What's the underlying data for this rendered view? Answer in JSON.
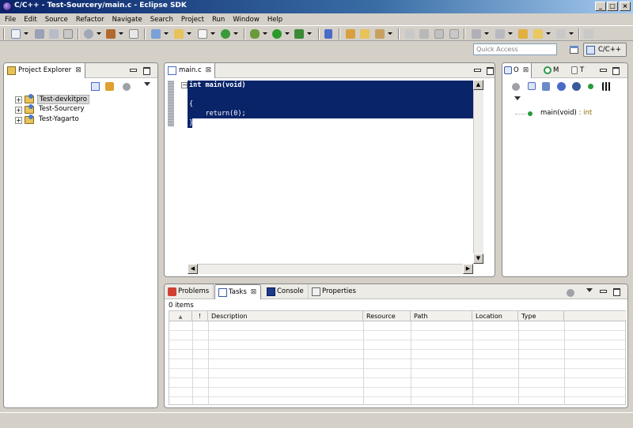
{
  "window": {
    "title": "C/C++ - Test-Sourcery/main.c - Eclipse SDK",
    "controls": {
      "minimize": "_",
      "maximize": "□",
      "close": "×"
    }
  },
  "menu": [
    "File",
    "Edit",
    "Source",
    "Refactor",
    "Navigate",
    "Search",
    "Project",
    "Run",
    "Window",
    "Help"
  ],
  "toolbar": {
    "icons": [
      "new-icon",
      "save-icon",
      "save-all-icon",
      "print-icon",
      "build-settings-icon",
      "build-icon",
      "binary-icon",
      "new-class-icon",
      "new-folder-icon",
      "new-file-icon",
      "refresh-icon",
      "debug-icon",
      "run-icon",
      "external-tools-icon",
      "toggle-breakpoint-icon",
      "open-type-icon",
      "open-folder-icon",
      "search-icon",
      "edit-icon",
      "annotation-icon",
      "task-icon",
      "bookmark-icon",
      "next-annotation-icon",
      "prev-annotation-icon",
      "back-icon",
      "forward-icon",
      "pin-icon"
    ]
  },
  "perspective": {
    "quick_access_placeholder": "Quick Access",
    "active": "C/C++"
  },
  "project_explorer": {
    "title": "Project Explorer",
    "projects": [
      {
        "name": "Test-devkitpro",
        "selected": true
      },
      {
        "name": "Test-Sourcery",
        "selected": false
      },
      {
        "name": "Test-Yagarto",
        "selected": false
      }
    ]
  },
  "editor": {
    "tab": "main.c",
    "code": [
      "int main(void)",
      "",
      "{",
      "    return(0);",
      "}"
    ]
  },
  "outline": {
    "tabs": [
      {
        "label": "O",
        "active": true
      },
      {
        "label": "M",
        "active": false
      },
      {
        "label": "T",
        "active": false
      }
    ],
    "items": [
      {
        "name": "main(void)",
        "type": " : int"
      }
    ]
  },
  "bottom_panel": {
    "tabs": [
      {
        "label": "Problems",
        "active": false
      },
      {
        "label": "Tasks",
        "active": true
      },
      {
        "label": "Console",
        "active": false
      },
      {
        "label": "Properties",
        "active": false
      }
    ],
    "item_count": "0 items",
    "columns": [
      "",
      "!",
      "Description",
      "Resource",
      "Path",
      "Location",
      "Type"
    ]
  },
  "colors": {
    "selection": "#0a246a",
    "title_bar": "#0a246a",
    "chrome": "#d4d0c8"
  }
}
